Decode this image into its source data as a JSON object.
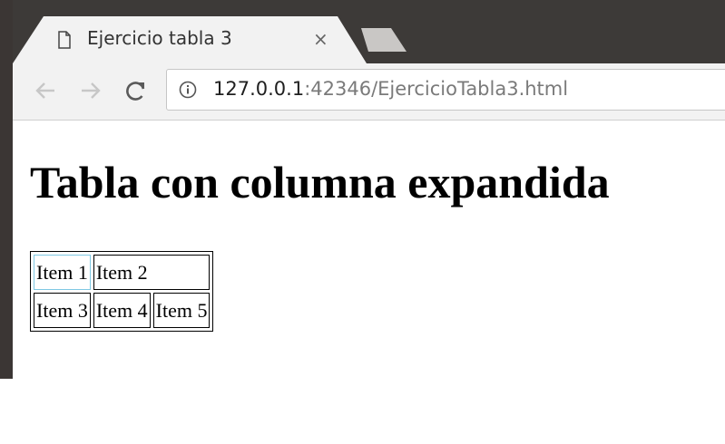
{
  "browser": {
    "tab_title": "Ejercicio tabla 3",
    "tab_close": "×",
    "url_host": "127.0.0.1",
    "url_rest": ":42346/EjercicioTabla3.html"
  },
  "page": {
    "heading": "Tabla con columna expandida",
    "table": {
      "rows": [
        [
          "Item 1",
          "Item 2"
        ],
        [
          "Item 3",
          "Item 4",
          "Item 5"
        ]
      ]
    }
  }
}
